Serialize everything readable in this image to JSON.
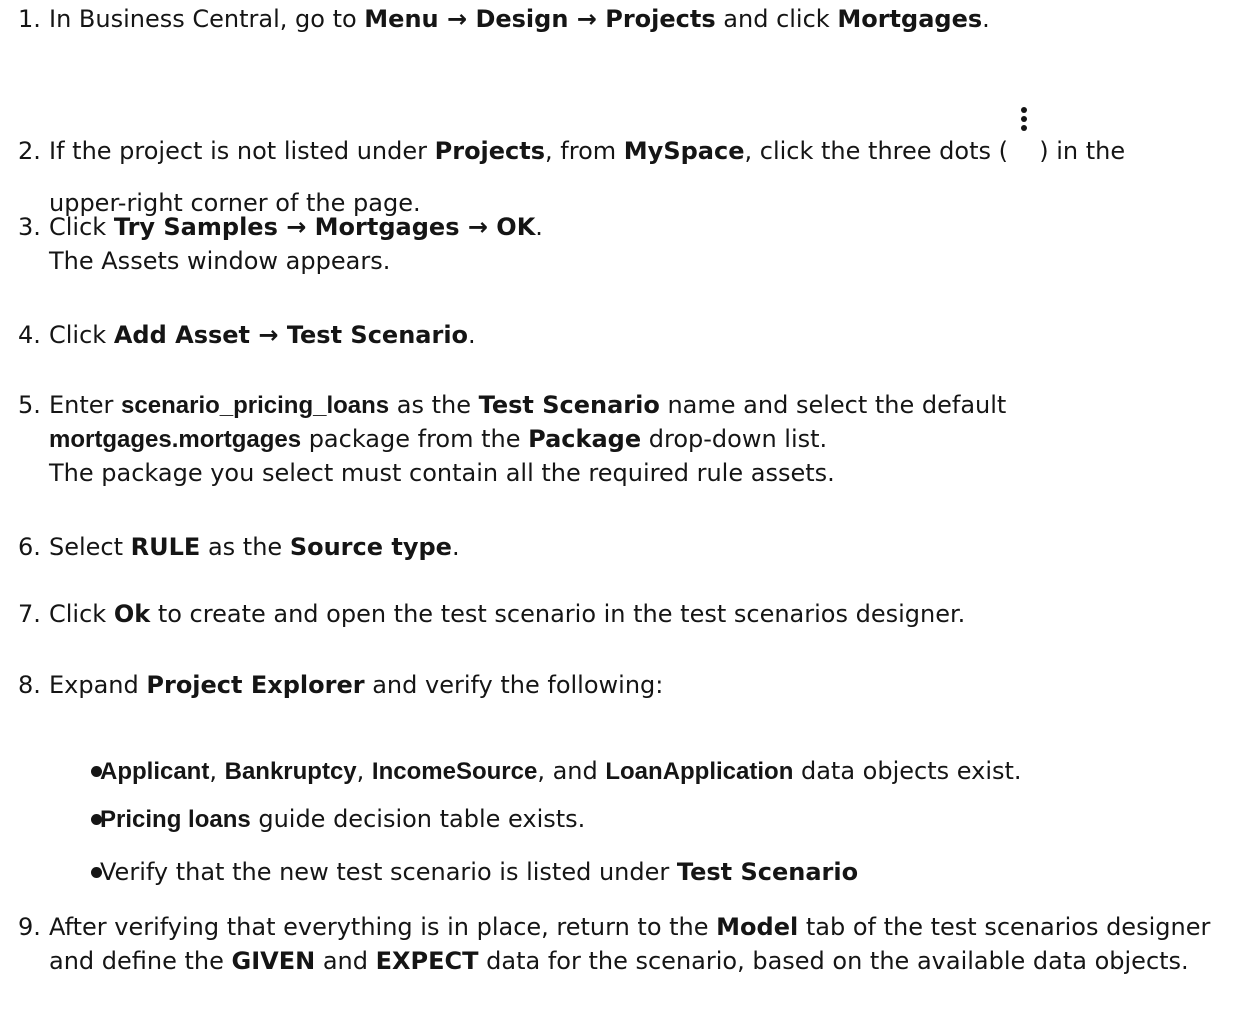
{
  "steps": [
    {
      "number": "1.",
      "lines": [
        [
          {
            "t": "In Business Central, go to "
          },
          {
            "t": "Menu → Design → Projects",
            "s": "b"
          },
          {
            "t": " and click "
          },
          {
            "t": "Mortgages",
            "s": "b"
          },
          {
            "t": "."
          }
        ]
      ]
    },
    {
      "number": "2.",
      "lines": [
        [
          {
            "t": "If the project is not listed under "
          },
          {
            "t": "Projects",
            "s": "b"
          },
          {
            "t": ", from "
          },
          {
            "t": "MySpace",
            "s": "b"
          },
          {
            "t": ", click the three dots ( "
          },
          {
            "icon": "kebab-menu-icon"
          },
          {
            "t": " ) in the"
          }
        ],
        [
          {
            "t": "upper-right corner of the page."
          }
        ]
      ]
    },
    {
      "number": "3.",
      "lines": [
        [
          {
            "t": "Click "
          },
          {
            "t": "Try Samples → Mortgages → OK",
            "s": "b"
          },
          {
            "t": "."
          }
        ],
        [
          {
            "t": "The Assets window appears."
          }
        ]
      ]
    },
    {
      "number": "4.",
      "lines": [
        [
          {
            "t": "Click "
          },
          {
            "t": "Add Asset → Test Scenario",
            "s": "b"
          },
          {
            "t": "."
          }
        ]
      ]
    },
    {
      "number": "5.",
      "lines": [
        [
          {
            "t": "Enter "
          },
          {
            "t": "scenario_pricing_loans",
            "s": "ab"
          },
          {
            "t": " as the "
          },
          {
            "t": "Test Scenario",
            "s": "b"
          },
          {
            "t": " name and select the default"
          }
        ],
        [
          {
            "t": "mortgages.mortgages",
            "s": "ab"
          },
          {
            "t": " package from the "
          },
          {
            "t": "Package",
            "s": "b"
          },
          {
            "t": " drop-down list."
          }
        ],
        [
          {
            "t": "The package you select must contain all the required rule assets."
          }
        ]
      ]
    },
    {
      "number": "6.",
      "lines": [
        [
          {
            "t": "Select "
          },
          {
            "t": "RULE",
            "s": "b"
          },
          {
            "t": " as the "
          },
          {
            "t": "Source type",
            "s": "b"
          },
          {
            "t": "."
          }
        ]
      ]
    },
    {
      "number": "7.",
      "lines": [
        [
          {
            "t": "Click "
          },
          {
            "t": "Ok",
            "s": "b"
          },
          {
            "t": " to create and open the test scenario in the test scenarios designer."
          }
        ]
      ]
    },
    {
      "number": "8.",
      "lines": [
        [
          {
            "t": "Expand "
          },
          {
            "t": "Project Explorer",
            "s": "b"
          },
          {
            "t": " and verify the following:"
          }
        ]
      ],
      "bullets": [
        [
          {
            "t": "Applicant",
            "s": "ab"
          },
          {
            "t": ", "
          },
          {
            "t": "Bankruptcy",
            "s": "ab"
          },
          {
            "t": ", "
          },
          {
            "t": "IncomeSource",
            "s": "ab"
          },
          {
            "t": ", and "
          },
          {
            "t": "LoanApplication",
            "s": "ab"
          },
          {
            "t": " data objects exist."
          }
        ],
        [
          {
            "t": "Pricing loans",
            "s": "ab"
          },
          {
            "t": " guide decision table exists."
          }
        ],
        [
          {
            "t": "Verify that the new test scenario is listed under "
          },
          {
            "t": "Test Scenario",
            "s": "b"
          }
        ]
      ]
    },
    {
      "number": "9.",
      "lines": [
        [
          {
            "t": "After verifying that everything is in place, return to the "
          },
          {
            "t": "Model",
            "s": "b"
          },
          {
            "t": " tab of the test scenarios designer"
          }
        ],
        [
          {
            "t": "and define the "
          },
          {
            "t": "GIVEN",
            "s": "b"
          },
          {
            "t": " and "
          },
          {
            "t": "EXPECT",
            "s": "b"
          },
          {
            "t": " data for the scenario, based on the available data objects."
          }
        ]
      ]
    }
  ]
}
